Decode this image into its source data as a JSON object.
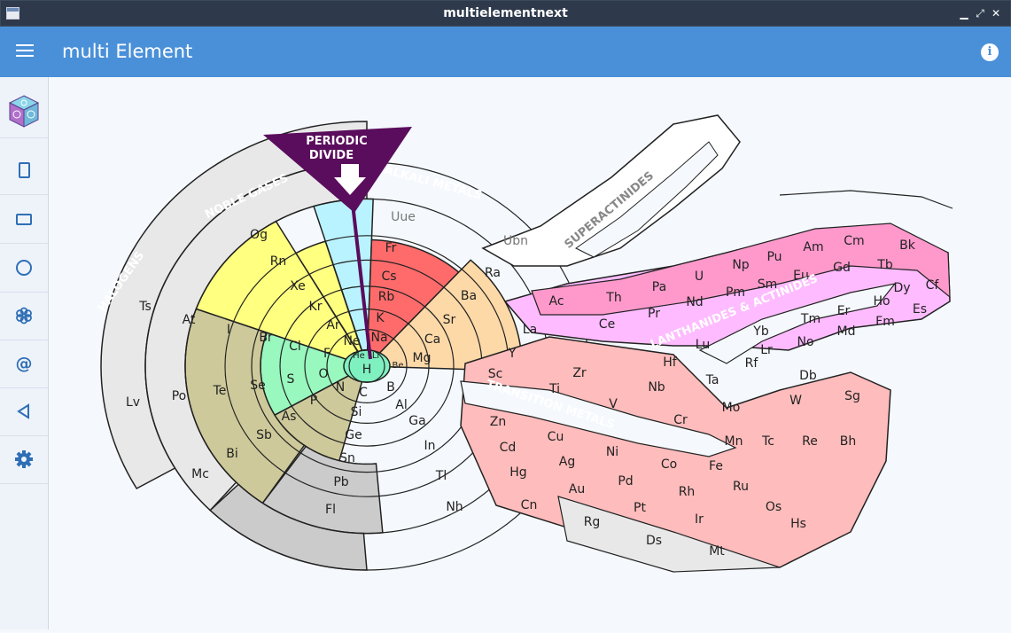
{
  "window": {
    "title": "multielementnext",
    "minimize": "▁",
    "maximize": "⤢",
    "close": "✕"
  },
  "appbar": {
    "title": "multi Element",
    "info_icon": "i"
  },
  "sidebar": {
    "items": [
      {
        "name": "app-logo-icon"
      },
      {
        "name": "portrait-icon"
      },
      {
        "name": "landscape-icon"
      },
      {
        "name": "circle-icon"
      },
      {
        "name": "flower-icon"
      },
      {
        "name": "at-icon"
      },
      {
        "name": "back-triangle-icon"
      },
      {
        "name": "gear-icon"
      }
    ]
  },
  "colors": {
    "titlebar": "#2e3a4c",
    "appbar": "#4a90d9",
    "noble": "#b9f3ff",
    "alkali": "#ff6b6b",
    "alkaline": "#fdd9a8",
    "halogen": "#ffff80",
    "nonmetal": "#98f8be",
    "metalloid": "#cdc99a",
    "post_transition": "#cbcbcb",
    "unknown": "#e8e8e8",
    "transition": "#ffbcbc",
    "actinide": "#ff99cc",
    "lanthanide": "#ffbbff",
    "divide": "#5a0d5c"
  },
  "chart": {
    "divide_label": [
      "PERIODIC",
      "DIVIDE"
    ],
    "arc_labels": {
      "noble": "NOBLE GASES",
      "alkali": "ALKALI METALS",
      "halogens": "HALOGENS",
      "super": "SUPERACTINIDES",
      "lanth": "LANTHANIDES & ACTINIDES",
      "trans": "TRANSITION METALS"
    },
    "elements": [
      [
        "Uue"
      ],
      [
        "Ubn"
      ],
      [
        "Og"
      ],
      [
        "Rn"
      ],
      [
        "Xe"
      ],
      [
        "Kr"
      ],
      [
        "Ar"
      ],
      [
        "Ne"
      ],
      [
        "He"
      ],
      [
        "Li"
      ],
      [
        "Be"
      ],
      [
        "H"
      ],
      [
        "Fr"
      ],
      [
        "Cs"
      ],
      [
        "Rb"
      ],
      [
        "K"
      ],
      [
        "Na"
      ],
      [
        "Ra"
      ],
      [
        "Ba"
      ],
      [
        "Sr"
      ],
      [
        "Ca"
      ],
      [
        "Mg"
      ],
      [
        "Ts"
      ],
      [
        "At"
      ],
      [
        "I"
      ],
      [
        "Br"
      ],
      [
        "Cl"
      ],
      [
        "F"
      ],
      [
        "O"
      ],
      [
        "N"
      ],
      [
        "C"
      ],
      [
        "B"
      ],
      [
        "Lv"
      ],
      [
        "Po"
      ],
      [
        "Te"
      ],
      [
        "Se"
      ],
      [
        "S"
      ],
      [
        "P"
      ],
      [
        "Si"
      ],
      [
        "Al"
      ],
      [
        "Mc"
      ],
      [
        "Bi"
      ],
      [
        "Sb"
      ],
      [
        "As"
      ],
      [
        "Ge"
      ],
      [
        "Ga"
      ],
      [
        "In"
      ],
      [
        "Tl"
      ],
      [
        "Nh"
      ],
      [
        "Sn"
      ],
      [
        "Pb"
      ],
      [
        "Fl"
      ],
      [
        "Ac"
      ],
      [
        "Th"
      ],
      [
        "Pa"
      ],
      [
        "U"
      ],
      [
        "Np"
      ],
      [
        "Pu"
      ],
      [
        "Am"
      ],
      [
        "Cm"
      ],
      [
        "Bk"
      ],
      [
        "Cf"
      ],
      [
        "Es"
      ],
      [
        "Fm"
      ],
      [
        "Md"
      ],
      [
        "No"
      ],
      [
        "Lr"
      ],
      [
        "La"
      ],
      [
        "Ce"
      ],
      [
        "Pr"
      ],
      [
        "Nd"
      ],
      [
        "Pm"
      ],
      [
        "Sm"
      ],
      [
        "Eu"
      ],
      [
        "Gd"
      ],
      [
        "Tb"
      ],
      [
        "Dy"
      ],
      [
        "Ho"
      ],
      [
        "Er"
      ],
      [
        "Tm"
      ],
      [
        "Yb"
      ],
      [
        "Lu"
      ],
      [
        "Sc"
      ],
      [
        "Y"
      ],
      [
        "Ti"
      ],
      [
        "Zr"
      ],
      [
        "Hf"
      ],
      [
        "Rf"
      ],
      [
        "V"
      ],
      [
        "Nb"
      ],
      [
        "Ta"
      ],
      [
        "Db"
      ],
      [
        "Cr"
      ],
      [
        "Mo"
      ],
      [
        "W"
      ],
      [
        "Sg"
      ],
      [
        "Mn"
      ],
      [
        "Tc"
      ],
      [
        "Re"
      ],
      [
        "Bh"
      ],
      [
        "Fe"
      ],
      [
        "Ru"
      ],
      [
        "Os"
      ],
      [
        "Hs"
      ],
      [
        "Co"
      ],
      [
        "Rh"
      ],
      [
        "Ir"
      ],
      [
        "Mt"
      ],
      [
        "Ni"
      ],
      [
        "Pd"
      ],
      [
        "Pt"
      ],
      [
        "Ds"
      ],
      [
        "Cu"
      ],
      [
        "Ag"
      ],
      [
        "Au"
      ],
      [
        "Rg"
      ],
      [
        "Zn"
      ],
      [
        "Cd"
      ],
      [
        "Hg"
      ],
      [
        "Cn"
      ]
    ]
  }
}
